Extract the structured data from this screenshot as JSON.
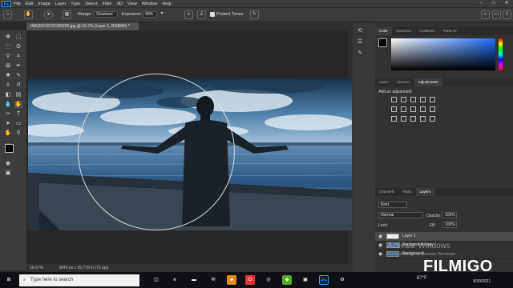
{
  "menubar": {
    "items": [
      "File",
      "Edit",
      "Image",
      "Layer",
      "Type",
      "Select",
      "Filter",
      "3D",
      "View",
      "Window",
      "Help"
    ]
  },
  "optionsbar": {
    "range_label": "Range:",
    "range_value": "Shadows",
    "exposure_label": "Exposure:",
    "exposure_value": "40%",
    "protect_tones": "Protect Tones"
  },
  "document": {
    "tab_title": "IMG20210723165202.jpg @ 16.7% (Layer 1, RGB/8#) *",
    "zoom": "16.67%",
    "dimensions": "3840 px x 35.778 in (72 ppi)"
  },
  "panels": {
    "color_tabs": [
      "Color",
      "Swatches",
      "Gradients",
      "Patterns"
    ],
    "adjust_tabs": [
      "Learn",
      "Libraries",
      "Adjustments"
    ],
    "adjust_hint": "Add an adjustment",
    "layers_tabs": [
      "Channels",
      "Paths",
      "Layers"
    ],
    "kind_label": "Kind",
    "blend_mode": "Normal",
    "opacity_label": "Opacity:",
    "opacity_value": "100%",
    "lock_label": "Lock:",
    "fill_label": "Fill:",
    "fill_value": "100%",
    "layers": [
      {
        "name": "Layer 1"
      },
      {
        "name": "Background copy"
      },
      {
        "name": "Background"
      }
    ]
  },
  "watermark": {
    "line1": "Activate Windows",
    "line2": "Go to Settings to activate Windows.",
    "brand": "FILMIGO"
  },
  "taskbar": {
    "search_placeholder": "Type here to search",
    "temperature": "87°F",
    "time": "",
    "date": "9/30/2021"
  },
  "colors": {
    "accent": "#31a8ff",
    "panel": "#323232",
    "taskbar": "#0f0f14"
  }
}
